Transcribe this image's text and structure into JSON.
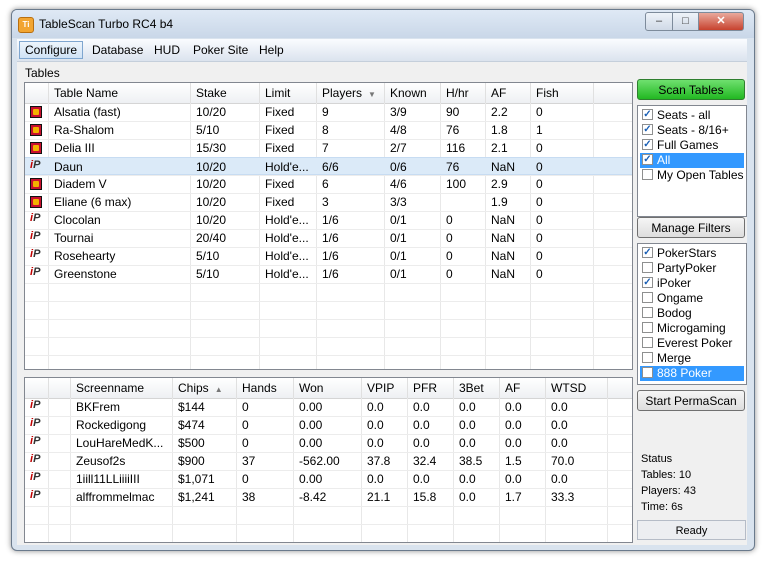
{
  "window": {
    "title": "TableScan Turbo RC4 b4",
    "icon_text": "Ti",
    "minimize_glyph": "–",
    "maximize_glyph": "□",
    "close_glyph": "✕"
  },
  "menu": [
    "Configure",
    "Database",
    "HUD",
    "Poker Site",
    "Help"
  ],
  "tables_label": "Tables",
  "tables": {
    "columns": [
      "",
      "Table Name",
      "Stake",
      "Limit",
      "Players",
      "Known",
      "H/hr",
      "AF",
      "Fish"
    ],
    "sort_column": "Players",
    "rows": [
      {
        "site": "pokerstars",
        "name": "Alsatia (fast)",
        "stake": "10/20",
        "limit": "Fixed",
        "players": "9",
        "known": "3/9",
        "hhr": "90",
        "af": "2.2",
        "fish": "0"
      },
      {
        "site": "pokerstars",
        "name": "Ra-Shalom",
        "stake": "5/10",
        "limit": "Fixed",
        "players": "8",
        "known": "4/8",
        "hhr": "76",
        "af": "1.8",
        "fish": "1"
      },
      {
        "site": "pokerstars",
        "name": "Delia III",
        "stake": "15/30",
        "limit": "Fixed",
        "players": "7",
        "known": "2/7",
        "hhr": "116",
        "af": "2.1",
        "fish": "0"
      },
      {
        "site": "ipoker",
        "name": "Daun",
        "stake": "10/20",
        "limit": "Hold'e...",
        "players": "6/6",
        "known": "0/6",
        "hhr": "76",
        "af": "NaN",
        "fish": "0"
      },
      {
        "site": "pokerstars",
        "name": "Diadem V",
        "stake": "10/20",
        "limit": "Fixed",
        "players": "6",
        "known": "4/6",
        "hhr": "100",
        "af": "2.9",
        "fish": "0"
      },
      {
        "site": "pokerstars",
        "name": "Eliane (6 max)",
        "stake": "10/20",
        "limit": "Fixed",
        "players": "3",
        "known": "3/3",
        "hhr": "",
        "af": "1.9",
        "fish": "0"
      },
      {
        "site": "ipoker",
        "name": "Clocolan",
        "stake": "10/20",
        "limit": "Hold'e...",
        "players": "1/6",
        "known": "0/1",
        "hhr": "0",
        "af": "NaN",
        "fish": "0"
      },
      {
        "site": "ipoker",
        "name": "Tournai",
        "stake": "20/40",
        "limit": "Hold'e...",
        "players": "1/6",
        "known": "0/1",
        "hhr": "0",
        "af": "NaN",
        "fish": "0"
      },
      {
        "site": "ipoker",
        "name": "Rosehearty",
        "stake": "5/10",
        "limit": "Hold'e...",
        "players": "1/6",
        "known": "0/1",
        "hhr": "0",
        "af": "NaN",
        "fish": "0"
      },
      {
        "site": "ipoker",
        "name": "Greenstone",
        "stake": "5/10",
        "limit": "Hold'e...",
        "players": "1/6",
        "known": "0/1",
        "hhr": "0",
        "af": "NaN",
        "fish": "0"
      }
    ],
    "selected_row": 3
  },
  "players": {
    "columns": [
      "",
      "",
      "Screenname",
      "Chips",
      "Hands",
      "Won",
      "VPIP",
      "PFR",
      "3Bet",
      "AF",
      "WTSD"
    ],
    "sort_column": "Chips",
    "rows": [
      {
        "site": "ipoker",
        "name": "BKFrem",
        "chips": "$144",
        "hands": "0",
        "won": "0.00",
        "vpip": "0.0",
        "pfr": "0.0",
        "threebet": "0.0",
        "af": "0.0",
        "wtsd": "0.0"
      },
      {
        "site": "ipoker",
        "name": "Rockedigong",
        "chips": "$474",
        "hands": "0",
        "won": "0.00",
        "vpip": "0.0",
        "pfr": "0.0",
        "threebet": "0.0",
        "af": "0.0",
        "wtsd": "0.0"
      },
      {
        "site": "ipoker",
        "name": "LouHareMedK...",
        "chips": "$500",
        "hands": "0",
        "won": "0.00",
        "vpip": "0.0",
        "pfr": "0.0",
        "threebet": "0.0",
        "af": "0.0",
        "wtsd": "0.0"
      },
      {
        "site": "ipoker",
        "name": "Zeusof2s",
        "chips": "$900",
        "hands": "37",
        "won": "-562.00",
        "vpip": "37.8",
        "pfr": "32.4",
        "threebet": "38.5",
        "af": "1.5",
        "wtsd": "70.0"
      },
      {
        "site": "ipoker",
        "name": "1iill11LLiiiiIII",
        "chips": "$1,071",
        "hands": "0",
        "won": "0.00",
        "vpip": "0.0",
        "pfr": "0.0",
        "threebet": "0.0",
        "af": "0.0",
        "wtsd": "0.0"
      },
      {
        "site": "ipoker",
        "name": "alffrommelmac",
        "chips": "$1,241",
        "hands": "38",
        "won": "-8.42",
        "vpip": "21.1",
        "pfr": "15.8",
        "threebet": "0.0",
        "af": "1.7",
        "wtsd": "33.3"
      }
    ]
  },
  "sidebar": {
    "scan_button": "Scan Tables",
    "filters": [
      {
        "label": "Seats - all",
        "checked": true,
        "highlight": false
      },
      {
        "label": "Seats - 8/16+",
        "checked": true,
        "highlight": false
      },
      {
        "label": "Full Games",
        "checked": true,
        "highlight": false
      },
      {
        "label": "All",
        "checked": true,
        "highlight": true
      },
      {
        "label": "My Open Tables",
        "checked": false,
        "highlight": false
      }
    ],
    "manage_filters_button": "Manage Filters",
    "sites": [
      {
        "label": "PokerStars",
        "checked": true,
        "highlight": false
      },
      {
        "label": "PartyPoker",
        "checked": false,
        "highlight": false
      },
      {
        "label": "iPoker",
        "checked": true,
        "highlight": false
      },
      {
        "label": "Ongame",
        "checked": false,
        "highlight": false
      },
      {
        "label": "Bodog",
        "checked": false,
        "highlight": false
      },
      {
        "label": "Microgaming",
        "checked": false,
        "highlight": false
      },
      {
        "label": "Everest Poker",
        "checked": false,
        "highlight": false
      },
      {
        "label": "Merge",
        "checked": false,
        "highlight": false
      },
      {
        "label": "888 Poker",
        "checked": false,
        "highlight": true
      }
    ],
    "permascan_button": "Start PermaScan",
    "status": {
      "heading": "Status",
      "tables": "Tables: 10",
      "players": "Players: 43",
      "time": "Time: 6s"
    },
    "statusbar": "Ready"
  },
  "icons": {
    "check_mark": "✓",
    "sort_arrow": "▲",
    "sort_arrow_down": "▼",
    "ipoker_glyph_i": "i",
    "ipoker_glyph_p": "P"
  }
}
